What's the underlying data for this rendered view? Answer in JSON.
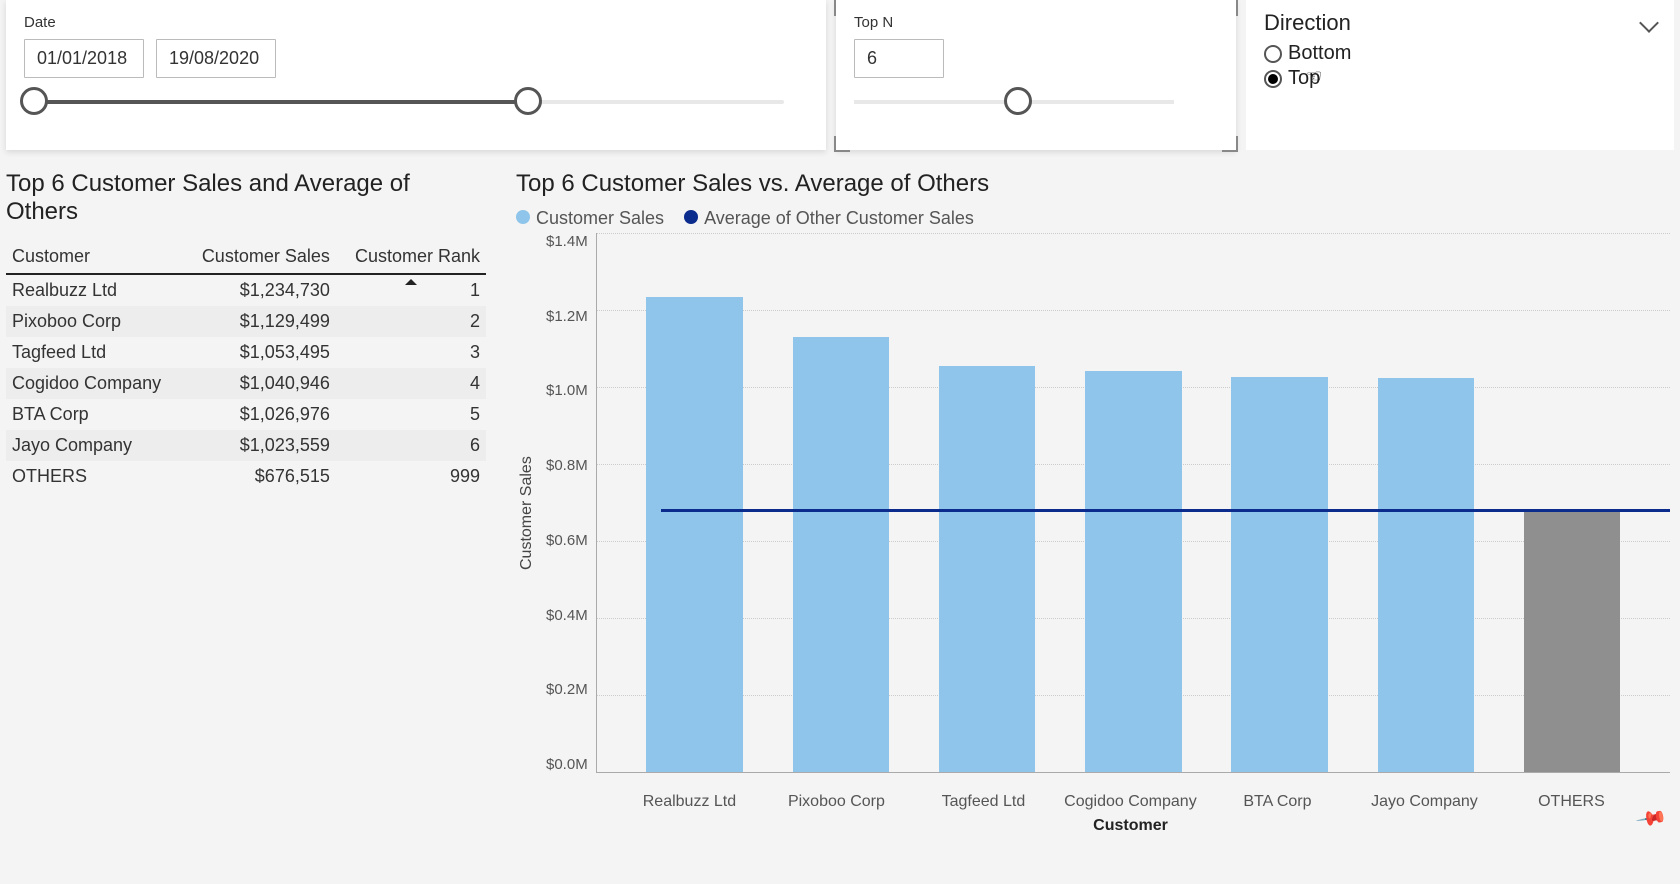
{
  "slicers": {
    "date": {
      "label": "Date",
      "from": "01/01/2018",
      "to": "19/08/2020"
    },
    "topn": {
      "label": "Top N",
      "value": "6"
    },
    "direction": {
      "label": "Direction",
      "options": {
        "bottom": "Bottom",
        "top": "Top"
      },
      "selected": "Top"
    }
  },
  "table": {
    "title": "Top 6 Customer Sales and Average of Others",
    "columns": {
      "c1": "Customer",
      "c2": "Customer Sales",
      "c3": "Customer Rank"
    },
    "rows": [
      {
        "customer": "Realbuzz Ltd",
        "sales": "$1,234,730",
        "rank": "1"
      },
      {
        "customer": "Pixoboo Corp",
        "sales": "$1,129,499",
        "rank": "2"
      },
      {
        "customer": "Tagfeed Ltd",
        "sales": "$1,053,495",
        "rank": "3"
      },
      {
        "customer": "Cogidoo Company",
        "sales": "$1,040,946",
        "rank": "4"
      },
      {
        "customer": "BTA Corp",
        "sales": "$1,026,976",
        "rank": "5"
      },
      {
        "customer": "Jayo Company",
        "sales": "$1,023,559",
        "rank": "6"
      },
      {
        "customer": "OTHERS",
        "sales": "$676,515",
        "rank": "999"
      }
    ]
  },
  "chart": {
    "title": "Top 6 Customer Sales vs. Average of Others",
    "legend": {
      "bars": "Customer Sales",
      "line": "Average of Other Customer Sales"
    },
    "ylabel": "Customer Sales",
    "xlabel": "Customer",
    "yticks": [
      "$1.4M",
      "$1.2M",
      "$1.0M",
      "$0.8M",
      "$0.6M",
      "$0.4M",
      "$0.2M",
      "$0.0M"
    ]
  },
  "chart_data": {
    "type": "bar",
    "categories": [
      "Realbuzz Ltd",
      "Pixoboo Corp",
      "Tagfeed Ltd",
      "Cogidoo Company",
      "BTA Corp",
      "Jayo Company",
      "OTHERS"
    ],
    "series": [
      {
        "name": "Customer Sales",
        "values": [
          1234730,
          1129499,
          1053495,
          1040946,
          1026976,
          1023559,
          676515
        ]
      },
      {
        "name": "Average of Other Customer Sales",
        "values": [
          676515,
          676515,
          676515,
          676515,
          676515,
          676515,
          676515
        ]
      }
    ],
    "title": "Top 6 Customer Sales vs. Average of Others",
    "xlabel": "Customer",
    "ylabel": "Customer Sales",
    "ylim": [
      0,
      1400000
    ],
    "colors": {
      "bars": "#8fc5ea",
      "others_bar": "#8f8f8f",
      "line": "#0b2b8d"
    }
  }
}
